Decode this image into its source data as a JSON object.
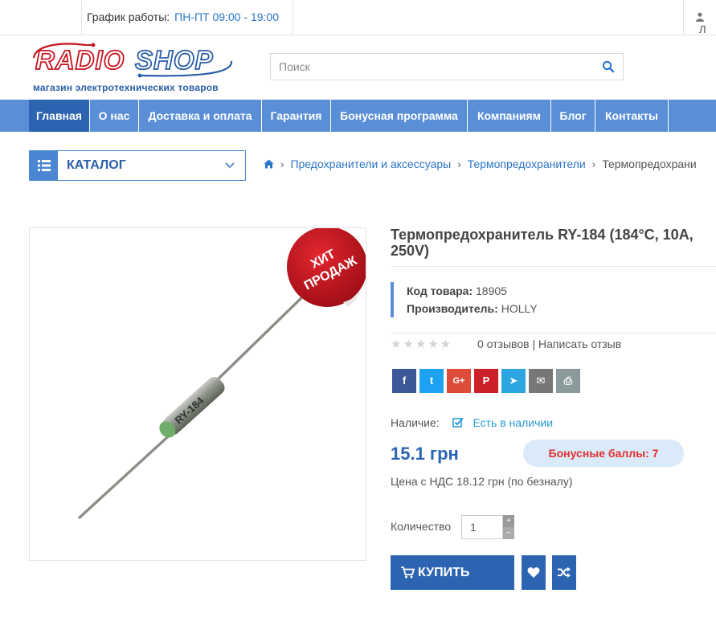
{
  "topbar": {
    "schedule_label": "График работы:",
    "schedule_hours": "ПН-ПТ 09:00 - 19:00",
    "user_icon": "user-icon",
    "user_text": "Л"
  },
  "logo": {
    "text_radio": "RADIO",
    "text_shop": "SHOP",
    "tagline": "магазин электротехнических товаров"
  },
  "search": {
    "placeholder": "Поиск",
    "value": "",
    "icon": "search-icon"
  },
  "nav": {
    "items": [
      {
        "label": "Главная",
        "active": true
      },
      {
        "label": "О нас"
      },
      {
        "label": "Доставка и оплата"
      },
      {
        "label": "Гарантия"
      },
      {
        "label": "Бонусная программа"
      },
      {
        "label": "Компаниям"
      },
      {
        "label": "Блог"
      },
      {
        "label": "Контакты"
      }
    ]
  },
  "catalog": {
    "label": "КАТАЛОГ",
    "icon": "list-icon"
  },
  "breadcrumb": {
    "home_icon": "home-icon",
    "items": [
      "Предохранители и аксессуары",
      "Термопредохранители",
      "Термопредохрани"
    ]
  },
  "product": {
    "badge_line1": "ХИТ",
    "badge_line2": "ПРОДАЖ",
    "image_marking": "RY-184",
    "title": "Термопредохранитель RY-184 (184°C, 10A, 250V)",
    "sku_label": "Код товара:",
    "sku": "18905",
    "maker_label": "Производитель:",
    "maker": "HOLLY",
    "rating": 0,
    "stars": "★★★★★",
    "reviews": "0 отзывов",
    "reviews_sep": "|",
    "write_review": "Написать отзыв",
    "availability_label": "Наличие:",
    "availability": "Есть в наличии",
    "price": "15.1 грн",
    "bonus": "Бонусные баллы: 7",
    "vat_price": "Цена с НДС 18.12 грн (по безналу)",
    "qty_label": "Количество",
    "qty": "1",
    "qty_up": "+",
    "qty_down": "−",
    "buy_label": "КУПИТЬ"
  },
  "share": [
    {
      "name": "facebook-icon",
      "glyph": "f",
      "color": "#3b5998"
    },
    {
      "name": "twitter-icon",
      "glyph": "t",
      "color": "#1da1f2"
    },
    {
      "name": "google-plus-icon",
      "glyph": "G+",
      "color": "#dd4b39"
    },
    {
      "name": "pinterest-icon",
      "glyph": "P",
      "color": "#cb2027"
    },
    {
      "name": "telegram-icon",
      "glyph": "➤",
      "color": "#2ca5e0"
    },
    {
      "name": "email-icon",
      "glyph": "✉",
      "color": "#777777"
    },
    {
      "name": "print-icon",
      "glyph": "⎙",
      "color": "#8a9a9a"
    }
  ],
  "colors": {
    "nav": "#5a8fd8",
    "nav_active": "#2c64b2",
    "link": "#2a74c9",
    "price": "#2a64b2",
    "badge": "#c8151f",
    "bonus_bg": "#dbeaf8",
    "bonus_text": "#e03030"
  }
}
